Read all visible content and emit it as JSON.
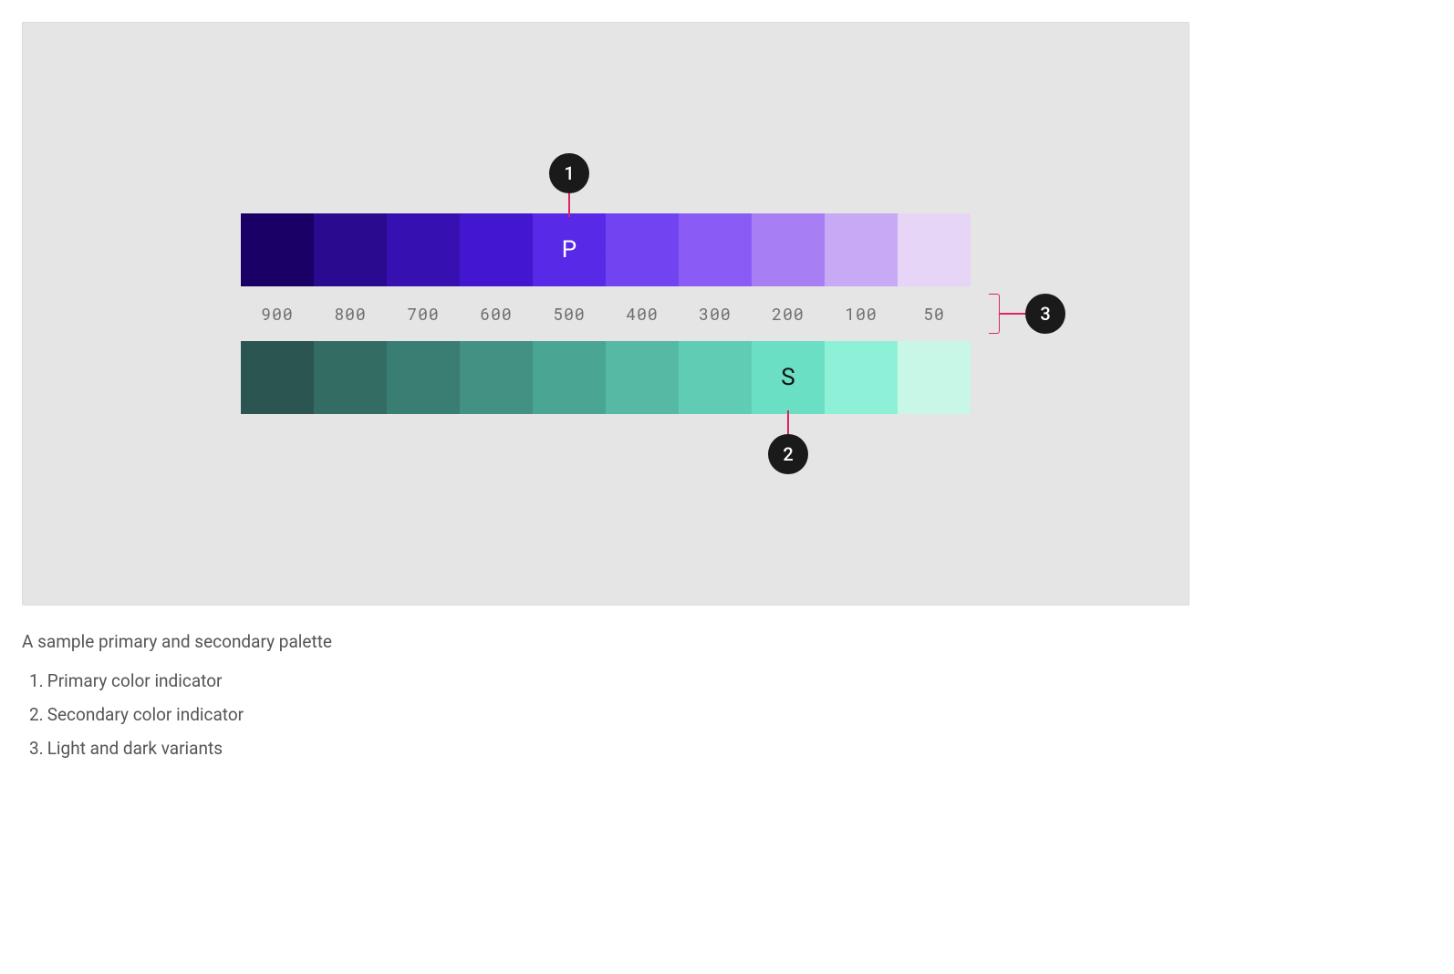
{
  "tonal_labels": [
    "900",
    "800",
    "700",
    "600",
    "500",
    "400",
    "300",
    "200",
    "100",
    "50"
  ],
  "primary": {
    "indicator_letter": "P",
    "indicator_index": 4,
    "swatches": [
      "#1a0066",
      "#2a0b8f",
      "#3610b0",
      "#4317cf",
      "#5829e6",
      "#7243f0",
      "#8a5cf5",
      "#a87ef5",
      "#c8a9f5",
      "#e6d5f7"
    ]
  },
  "secondary": {
    "indicator_letter": "S",
    "indicator_index": 7,
    "swatches": [
      "#2b5550",
      "#336c62",
      "#3a7d72",
      "#429183",
      "#4ba593",
      "#55b9a3",
      "#5fccb3",
      "#6adfc3",
      "#8ef0d6",
      "#c8f7e8"
    ]
  },
  "annotations": {
    "badge1": "1",
    "badge2": "2",
    "badge3": "3"
  },
  "caption": "A sample primary and secondary palette",
  "legend": [
    {
      "num": "1.",
      "text": "Primary color indicator"
    },
    {
      "num": "2.",
      "text": "Secondary color indicator"
    },
    {
      "num": "3.",
      "text": "Light and dark variants"
    }
  ]
}
